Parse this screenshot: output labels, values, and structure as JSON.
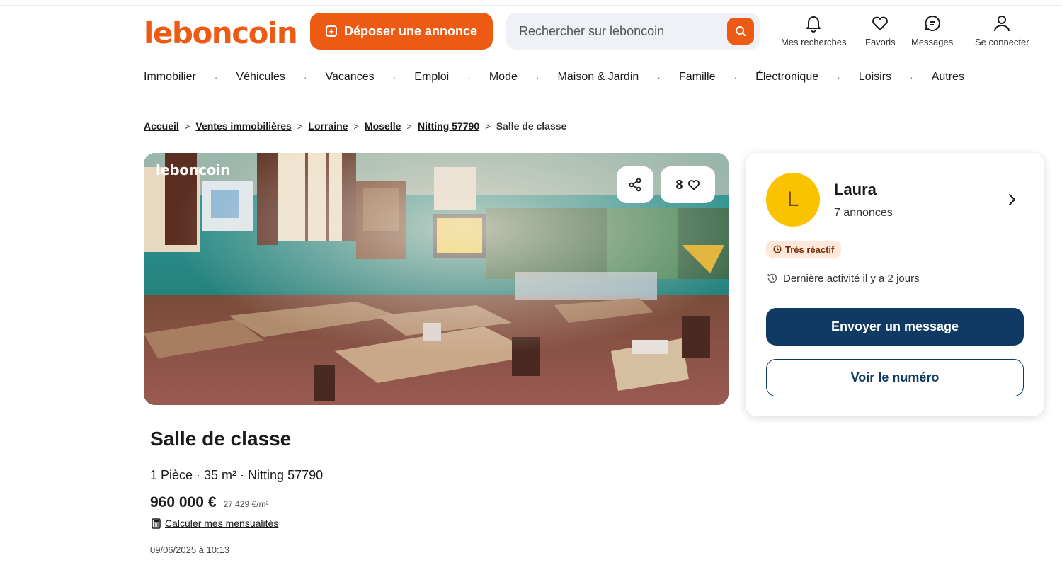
{
  "header": {
    "logo": "leboncoin",
    "deposit_label": "Déposer une annonce",
    "search_placeholder": "Rechercher sur leboncoin",
    "actions": [
      {
        "label": "Mes recherches",
        "icon": "bell-icon"
      },
      {
        "label": "Favoris",
        "icon": "heart-icon"
      },
      {
        "label": "Messages",
        "icon": "message-icon"
      },
      {
        "label": "Se connecter",
        "icon": "user-icon"
      }
    ],
    "brand_color": "#ec5a13"
  },
  "nav": {
    "items": [
      "Immobilier",
      "Véhicules",
      "Vacances",
      "Emploi",
      "Mode",
      "Maison & Jardin",
      "Famille",
      "Électronique",
      "Loisirs",
      "Autres"
    ]
  },
  "breadcrumb": {
    "links": [
      "Accueil",
      "Ventes immobilières",
      "Lorraine",
      "Moselle",
      "Nitting 57790"
    ],
    "current": "Salle de classe"
  },
  "gallery": {
    "watermark": "leboncoin",
    "favorites_count": "8"
  },
  "seller": {
    "initial": "L",
    "name": "Laura",
    "ads_count": "7 annonces",
    "badge": "Très réactif",
    "activity": "Dernière activité il y a 2 jours",
    "message_button": "Envoyer un message",
    "phone_button": "Voir le numéro",
    "button_color": "#0e3a63"
  },
  "listing": {
    "title": "Salle de classe",
    "details": "1 Pièce · 35 m² · Nitting 57790",
    "price": "960 000 €",
    "price_per_m2": "27 429 €/m²",
    "calc_link": "Calculer mes mensualités",
    "date": "09/06/2025 à 10:13"
  }
}
